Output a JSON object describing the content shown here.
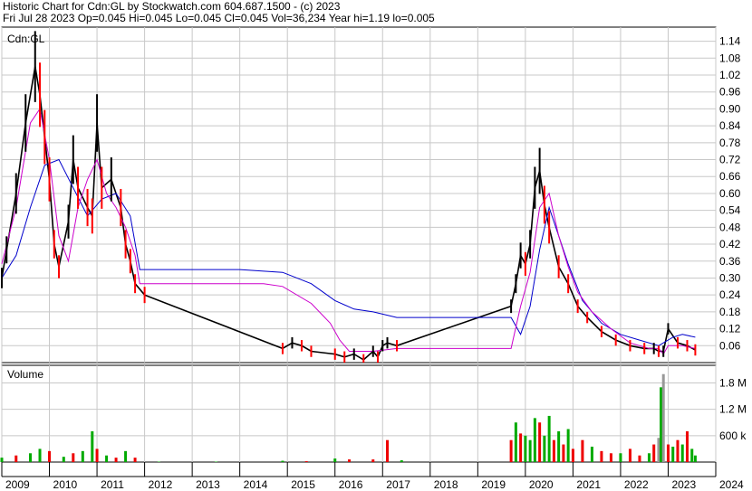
{
  "header": {
    "line1": "Historic Chart for Cdn:GL by Stockwatch.com 604.687.1500 - (c) 2023",
    "line2": "Fri Jul 28 2023  Op=0.045  Hi=0.045  Lo=0.045  Cl=0.045  Vol=36,234  Year hi=1.19  lo=0.005"
  },
  "chart_data": [
    {
      "type": "line",
      "symbol_label": "Cdn:GL",
      "title": "",
      "xlabel": "",
      "ylabel": "",
      "x_ticks": [
        "2009",
        "2010",
        "2011",
        "2012",
        "2013",
        "2014",
        "2015",
        "2016",
        "2017",
        "2018",
        "2019",
        "2020",
        "2021",
        "2022",
        "2023",
        "2024"
      ],
      "y_ticks": [
        "1.14",
        "1.08",
        "1.02",
        "0.96",
        "0.90",
        "0.84",
        "0.78",
        "0.72",
        "0.66",
        "0.60",
        "0.54",
        "0.48",
        "0.42",
        "0.36",
        "0.30",
        "0.24",
        "0.18",
        "0.12",
        "0.06"
      ],
      "ylim": [
        0.0,
        1.19
      ],
      "xlim": [
        2009.0,
        2024.0
      ],
      "grid": true,
      "colors": {
        "price": "#000000",
        "down": "#ff0000",
        "ma_short": "#cc00cc",
        "ma_long": "#0000cc"
      },
      "series": [
        {
          "id": "price",
          "x": [
            2009.0,
            2009.1,
            2009.3,
            2009.5,
            2009.7,
            2009.8,
            2009.9,
            2010.0,
            2010.1,
            2010.2,
            2010.4,
            2010.5,
            2010.6,
            2010.8,
            2010.9,
            2011.0,
            2011.1,
            2011.3,
            2011.5,
            2011.6,
            2011.7,
            2011.8,
            2012.0,
            2014.9,
            2015.1,
            2015.3,
            2015.5,
            2016.0,
            2016.2,
            2016.4,
            2016.6,
            2016.8,
            2016.9,
            2017.0,
            2017.1,
            2017.3,
            2019.7,
            2019.8,
            2019.9,
            2020.0,
            2020.1,
            2020.2,
            2020.3,
            2020.4,
            2020.5,
            2020.7,
            2020.9,
            2021.1,
            2021.3,
            2021.6,
            2021.9,
            2022.2,
            2022.5,
            2022.7,
            2022.8,
            2022.9,
            2023.0,
            2023.2,
            2023.4,
            2023.57
          ],
          "y": [
            0.3,
            0.4,
            0.6,
            0.85,
            1.05,
            0.95,
            0.8,
            0.65,
            0.42,
            0.34,
            0.5,
            0.72,
            0.62,
            0.55,
            0.52,
            0.85,
            0.62,
            0.65,
            0.55,
            0.42,
            0.36,
            0.28,
            0.24,
            0.05,
            0.07,
            0.06,
            0.04,
            0.03,
            0.02,
            0.03,
            0.01,
            0.04,
            0.02,
            0.06,
            0.07,
            0.06,
            0.2,
            0.28,
            0.38,
            0.35,
            0.42,
            0.62,
            0.68,
            0.56,
            0.48,
            0.34,
            0.28,
            0.2,
            0.16,
            0.11,
            0.08,
            0.06,
            0.05,
            0.05,
            0.04,
            0.04,
            0.12,
            0.07,
            0.06,
            0.045
          ]
        },
        {
          "id": "ma_short",
          "x": [
            2009.0,
            2009.3,
            2009.6,
            2009.8,
            2010.0,
            2010.2,
            2010.4,
            2010.6,
            2010.8,
            2011.0,
            2011.2,
            2011.4,
            2011.6,
            2011.8,
            2011.9,
            2012.5,
            2013.5,
            2014.5,
            2014.9,
            2015.5,
            2015.9,
            2016.1,
            2016.3,
            2016.5,
            2016.8,
            2017.3,
            2018.0,
            2019.0,
            2019.7,
            2019.9,
            2020.1,
            2020.3,
            2020.5,
            2020.7,
            2020.9,
            2021.1,
            2021.4,
            2021.8,
            2022.2,
            2022.6,
            2022.8,
            2022.9,
            2023.0,
            2023.3,
            2023.57
          ],
          "y": [
            0.35,
            0.55,
            0.85,
            0.9,
            0.72,
            0.45,
            0.36,
            0.55,
            0.65,
            0.72,
            0.6,
            0.55,
            0.48,
            0.38,
            0.28,
            0.28,
            0.28,
            0.28,
            0.27,
            0.21,
            0.14,
            0.08,
            0.04,
            0.04,
            0.04,
            0.05,
            0.05,
            0.05,
            0.05,
            0.2,
            0.32,
            0.55,
            0.6,
            0.45,
            0.34,
            0.25,
            0.18,
            0.12,
            0.07,
            0.05,
            0.05,
            0.03,
            0.06,
            0.06,
            0.05
          ]
        },
        {
          "id": "ma_long",
          "x": [
            2009.0,
            2009.3,
            2009.6,
            2009.9,
            2010.2,
            2010.5,
            2010.8,
            2011.1,
            2011.4,
            2011.7,
            2011.9,
            2013.0,
            2014.0,
            2014.9,
            2015.5,
            2016.0,
            2016.4,
            2016.8,
            2017.3,
            2018.0,
            2019.0,
            2019.7,
            2019.9,
            2020.1,
            2020.3,
            2020.5,
            2020.7,
            2020.9,
            2021.2,
            2021.6,
            2022.0,
            2022.4,
            2022.8,
            2022.9,
            2023.1,
            2023.3,
            2023.57
          ],
          "y": [
            0.3,
            0.38,
            0.55,
            0.7,
            0.72,
            0.62,
            0.52,
            0.58,
            0.6,
            0.52,
            0.33,
            0.33,
            0.33,
            0.32,
            0.28,
            0.22,
            0.19,
            0.18,
            0.16,
            0.16,
            0.16,
            0.16,
            0.1,
            0.2,
            0.4,
            0.55,
            0.45,
            0.35,
            0.22,
            0.14,
            0.1,
            0.08,
            0.06,
            0.07,
            0.09,
            0.1,
            0.09
          ]
        }
      ]
    },
    {
      "type": "bar",
      "title": "Volume",
      "xlabel": "",
      "ylabel": "",
      "y_ticks": [
        "1.8 M",
        "1.2 M",
        "600 k"
      ],
      "ylim": [
        0,
        2200000
      ],
      "xlim": [
        2009.0,
        2024.0
      ],
      "colors": {
        "up": "#00aa00",
        "down": "#ee0000",
        "flat": "#999999"
      },
      "x": [
        2009.0,
        2009.3,
        2009.6,
        2009.8,
        2010.0,
        2010.3,
        2010.5,
        2010.7,
        2010.9,
        2011.0,
        2011.2,
        2011.4,
        2011.6,
        2011.8,
        2012.3,
        2013.5,
        2014.9,
        2015.4,
        2016.0,
        2016.3,
        2016.8,
        2017.1,
        2017.4,
        2019.7,
        2019.8,
        2019.9,
        2020.0,
        2020.1,
        2020.2,
        2020.3,
        2020.4,
        2020.5,
        2020.6,
        2020.7,
        2020.8,
        2020.9,
        2021.0,
        2021.2,
        2021.4,
        2021.6,
        2021.8,
        2022.0,
        2022.2,
        2022.4,
        2022.6,
        2022.7,
        2022.8,
        2022.85,
        2022.9,
        2023.0,
        2023.1,
        2023.2,
        2023.3,
        2023.4,
        2023.5,
        2023.57
      ],
      "values": [
        100000,
        150000,
        200000,
        300000,
        250000,
        120000,
        200000,
        250000,
        700000,
        300000,
        150000,
        100000,
        250000,
        100000,
        10000,
        10000,
        30000,
        20000,
        80000,
        60000,
        60000,
        500000,
        40000,
        500000,
        900000,
        650000,
        600000,
        500000,
        1000000,
        900000,
        600000,
        1050000,
        500000,
        700000,
        400000,
        750000,
        300000,
        500000,
        350000,
        250000,
        200000,
        200000,
        300000,
        150000,
        200000,
        400000,
        550000,
        1700000,
        2000000,
        400000,
        350000,
        500000,
        400000,
        700000,
        300000,
        150000
      ],
      "dir": [
        "up",
        "down",
        "up",
        "up",
        "down",
        "up",
        "down",
        "up",
        "up",
        "down",
        "up",
        "down",
        "up",
        "down",
        "up",
        "up",
        "up",
        "down",
        "up",
        "down",
        "down",
        "down",
        "up",
        "down",
        "up",
        "down",
        "up",
        "up",
        "up",
        "down",
        "up",
        "up",
        "down",
        "up",
        "down",
        "up",
        "down",
        "down",
        "up",
        "down",
        "down",
        "up",
        "down",
        "down",
        "up",
        "down",
        "flat",
        "up",
        "flat",
        "down",
        "up",
        "down",
        "up",
        "down",
        "up",
        "up"
      ]
    }
  ]
}
